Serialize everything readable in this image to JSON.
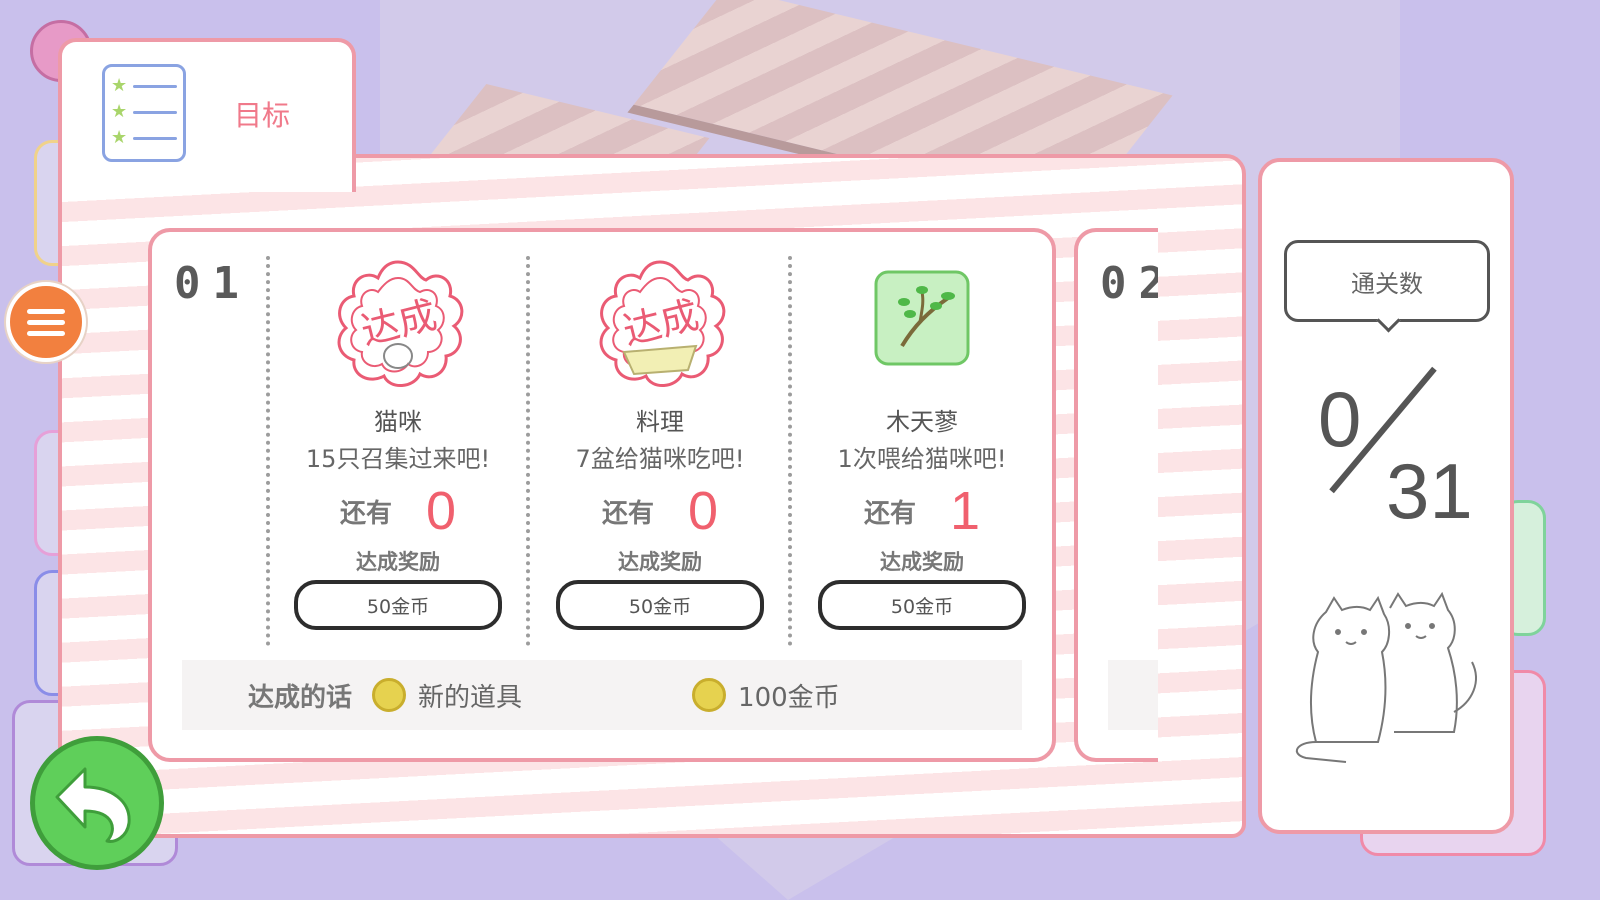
{
  "objectives_tab": {
    "label": "目标"
  },
  "card1": {
    "number": "01",
    "goals": [
      {
        "stamp": "达成",
        "name": "猫咪",
        "desc": "15只召集过来吧!",
        "remain_label": "还有",
        "remain": "0",
        "reward_title": "达成奖励",
        "reward": "50金币",
        "icon": "cat-icon",
        "achieved": true
      },
      {
        "stamp": "达成",
        "name": "料理",
        "desc": "7盆给猫咪吃吧!",
        "remain_label": "还有",
        "remain": "0",
        "reward_title": "达成奖励",
        "reward": "50金币",
        "icon": "food-bowl-icon",
        "achieved": true
      },
      {
        "stamp": "",
        "name": "木天蓼",
        "desc": "1次喂给猫咪吧!",
        "remain_label": "还有",
        "remain": "1",
        "reward_title": "达成奖励",
        "reward": "50金币",
        "icon": "silvervine-branch-icon",
        "achieved": false
      }
    ],
    "bonus": {
      "label": "达成的话",
      "item1": "新的道具",
      "item2": "100金币"
    }
  },
  "card2": {
    "number": "02"
  },
  "stats": {
    "title": "通关数",
    "cleared": "0",
    "total": "31"
  },
  "colors": {
    "accent_pink": "#ee9aa7",
    "remain_red": "#f0606e",
    "menu_orange": "#f2803f",
    "back_green": "#5fcf5a"
  },
  "icons": {
    "menu": "hamburger-menu-icon",
    "back": "back-arrow-icon",
    "objectives": "checklist-icon"
  }
}
